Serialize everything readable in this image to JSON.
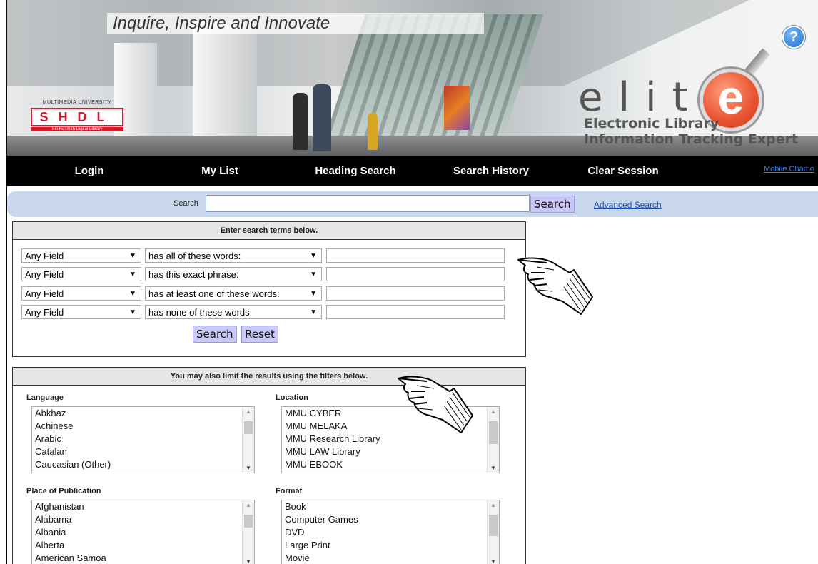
{
  "header": {
    "tagline": "Inquire, Inspire and Innovate",
    "logo_top": "MULTIMEDIA UNIVERSITY",
    "logo_main": "SHDL",
    "logo_sub": "Siti Hasmah Digital Library",
    "brand_word": "elit",
    "brand_e": "e",
    "brand_line1": "Electronic Library",
    "brand_line2": "Information Tracking Expert",
    "help_symbol": "?"
  },
  "nav": {
    "items": [
      {
        "label": "Login"
      },
      {
        "label": "My List"
      },
      {
        "label": "Heading Search"
      },
      {
        "label": "Search History"
      },
      {
        "label": "Clear Session"
      }
    ],
    "mobile_link": "Mobile Chamo"
  },
  "search_bar": {
    "label": "Search",
    "value": "",
    "button": "Search",
    "advanced_link": "Advanced Search"
  },
  "advanced": {
    "heading": "Enter search terms below.",
    "rows": [
      {
        "field": "Any Field",
        "operator": "has all of these words:",
        "value": ""
      },
      {
        "field": "Any Field",
        "operator": "has this exact phrase:",
        "value": ""
      },
      {
        "field": "Any Field",
        "operator": "has at least one of these words:",
        "value": ""
      },
      {
        "field": "Any Field",
        "operator": "has none of these words:",
        "value": ""
      }
    ],
    "search_button": "Search",
    "reset_button": "Reset"
  },
  "filters": {
    "heading": "You may also limit the results using the filters below.",
    "language": {
      "label": "Language",
      "options": [
        "Abkhaz",
        "Achinese",
        "Arabic",
        "Catalan",
        "Caucasian (Other)"
      ]
    },
    "location": {
      "label": "Location",
      "options": [
        "MMU CYBER",
        "MMU MELAKA",
        "MMU Research Library",
        "MMU LAW Library",
        "MMU EBOOK"
      ]
    },
    "place": {
      "label": "Place of Publication",
      "options": [
        "Afghanistan",
        "Alabama",
        "Albania",
        "Alberta",
        "American Samoa"
      ]
    },
    "format": {
      "label": "Format",
      "options": [
        "Book",
        "Computer Games",
        "DVD",
        "Large Print",
        "Movie"
      ]
    }
  },
  "icons": {
    "pointer": "pointing-hand-icon",
    "help": "help-icon",
    "dropdown": "chevron-down-icon"
  },
  "colors": {
    "nav_bg": "#000000",
    "search_bar_bg": "#c9d8ec",
    "button_bg": "#c9c8f7",
    "brand_orange": "#e9532f",
    "logo_red": "#d41b2c",
    "link_blue": "#1a4fb8"
  }
}
